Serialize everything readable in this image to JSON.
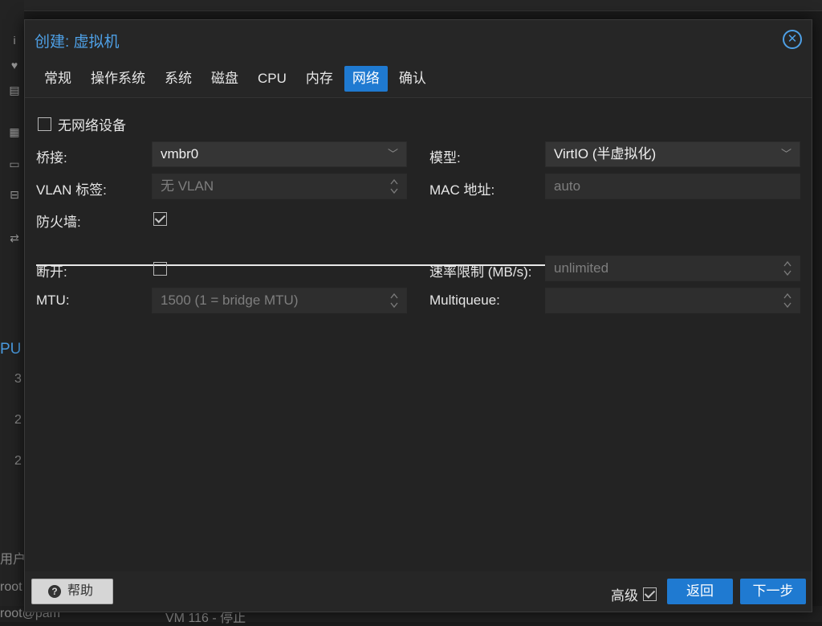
{
  "dialog": {
    "title": "创建: 虚拟机",
    "close_icon": "close-circle-icon"
  },
  "tabs": [
    {
      "label": "常规"
    },
    {
      "label": "操作系统"
    },
    {
      "label": "系统"
    },
    {
      "label": "磁盘"
    },
    {
      "label": "CPU"
    },
    {
      "label": "内存"
    },
    {
      "label": "网络",
      "active": true
    },
    {
      "label": "确认"
    }
  ],
  "network": {
    "no_device_label": "无网络设备",
    "no_device_checked": false,
    "bridge_label": "桥接:",
    "bridge_value": "vmbr0",
    "model_label": "模型:",
    "model_value": "VirtIO (半虚拟化)",
    "vlan_label": "VLAN 标签:",
    "vlan_placeholder": "无 VLAN",
    "mac_label": "MAC 地址:",
    "mac_placeholder": "auto",
    "firewall_label": "防火墙:",
    "firewall_checked": true,
    "disconnect_label": "断开:",
    "disconnect_checked": false,
    "rate_label": "速率限制 (MB/s):",
    "rate_placeholder": "unlimited",
    "mtu_label": "MTU:",
    "mtu_placeholder": "1500 (1 = bridge MTU)",
    "multiqueue_label": "Multiqueue:",
    "multiqueue_value": ""
  },
  "footer": {
    "help_label": "帮助",
    "advanced_label": "高级",
    "advanced_checked": true,
    "back_label": "返回",
    "next_label": "下一步"
  },
  "background": {
    "side_text_1": "PU",
    "row_1": "3",
    "row_2": "2",
    "row_3": "2",
    "user_header": "用户",
    "user_1": "root",
    "user_2": "root@pam",
    "task_text": "VM 116 - 停止"
  },
  "colors": {
    "accent": "#1f7ad1",
    "title": "#4ea0e6",
    "dialog_bg": "#262626"
  }
}
